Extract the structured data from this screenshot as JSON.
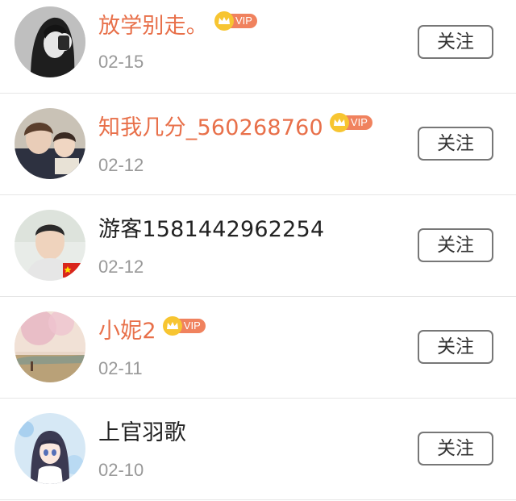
{
  "follow_list": {
    "items": [
      {
        "name": "放学别走。",
        "vip": true,
        "vip_label": "VIP",
        "date": "02-15",
        "button_label": "关注",
        "avatar_icon": "avatar-girl-bw"
      },
      {
        "name": "知我几分_560268760",
        "vip": true,
        "vip_label": "VIP",
        "date": "02-12",
        "button_label": "关注",
        "avatar_icon": "avatar-two-boys"
      },
      {
        "name": "游客1581442962254",
        "vip": false,
        "date": "02-12",
        "button_label": "关注",
        "avatar_icon": "avatar-boy-flag"
      },
      {
        "name": "小妮2",
        "vip": true,
        "vip_label": "VIP",
        "date": "02-11",
        "button_label": "关注",
        "avatar_icon": "avatar-blossom-landscape"
      },
      {
        "name": "上官羽歌",
        "vip": false,
        "date": "02-10",
        "button_label": "关注",
        "avatar_icon": "avatar-anime-girl"
      }
    ]
  },
  "colors": {
    "vip_name": "#e8704a",
    "vip_badge": "#f0825e",
    "vip_crown": "#f7c531",
    "date_text": "#999999",
    "button_border": "#777777"
  }
}
